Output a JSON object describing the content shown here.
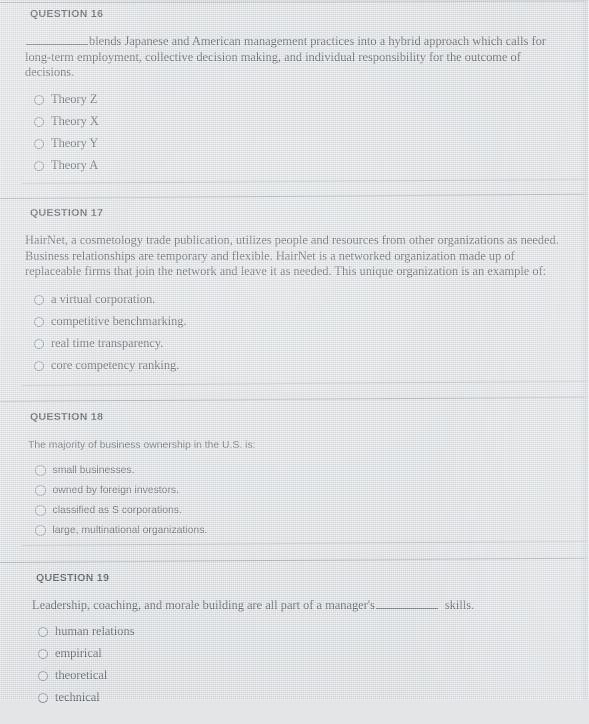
{
  "page": {
    "background_color": "#e3e5e7",
    "text_color": "#4d5258",
    "rule_color": "#b3b9c0"
  },
  "questions": [
    {
      "header": "QUESTION 16",
      "body_before_blank": "",
      "has_leading_blank": true,
      "body": "blends Japanese and American management practices into a hybrid approach which calls for long-term employment, collective decision making, and individual responsibility for the outcome of decisions.",
      "font": "serif",
      "options": [
        {
          "label": "Theory Z",
          "selected": false
        },
        {
          "label": "Theory X",
          "selected": false
        },
        {
          "label": "Theory Y",
          "selected": false
        },
        {
          "label": "Theory A",
          "selected": false
        }
      ]
    },
    {
      "header": "QUESTION 17",
      "body": "HairNet, a cosmetology trade publication, utilizes people and resources from other organizations as needed. Business relationships are temporary and flexible. HairNet is a networked organization made up of replaceable firms that join the network and leave it as needed. This unique organization is an example of:",
      "font": "serif",
      "options": [
        {
          "label": "a virtual corporation.",
          "selected": false
        },
        {
          "label": "competitive benchmarking.",
          "selected": false
        },
        {
          "label": "real time transparency.",
          "selected": false
        },
        {
          "label": "core competency ranking.",
          "selected": false
        }
      ]
    },
    {
      "header": "QUESTION 18",
      "body": "The majority of business ownership in the U.S. is:",
      "font": "sans",
      "options": [
        {
          "label": "small businesses.",
          "selected": false
        },
        {
          "label": "owned by foreign investors.",
          "selected": false
        },
        {
          "label": "classified as S corporations.",
          "selected": false
        },
        {
          "label": "large, multinational organizations.",
          "selected": false
        }
      ]
    },
    {
      "header": "QUESTION 19",
      "body_part1": "Leadership, coaching, and morale building are all part of a manager's",
      "body_part2": "skills.",
      "font": "serif",
      "options": [
        {
          "label": "human relations",
          "selected": false
        },
        {
          "label": "empirical",
          "selected": false
        },
        {
          "label": "theoretical",
          "selected": false
        },
        {
          "label": "technical",
          "selected": false
        }
      ]
    }
  ]
}
